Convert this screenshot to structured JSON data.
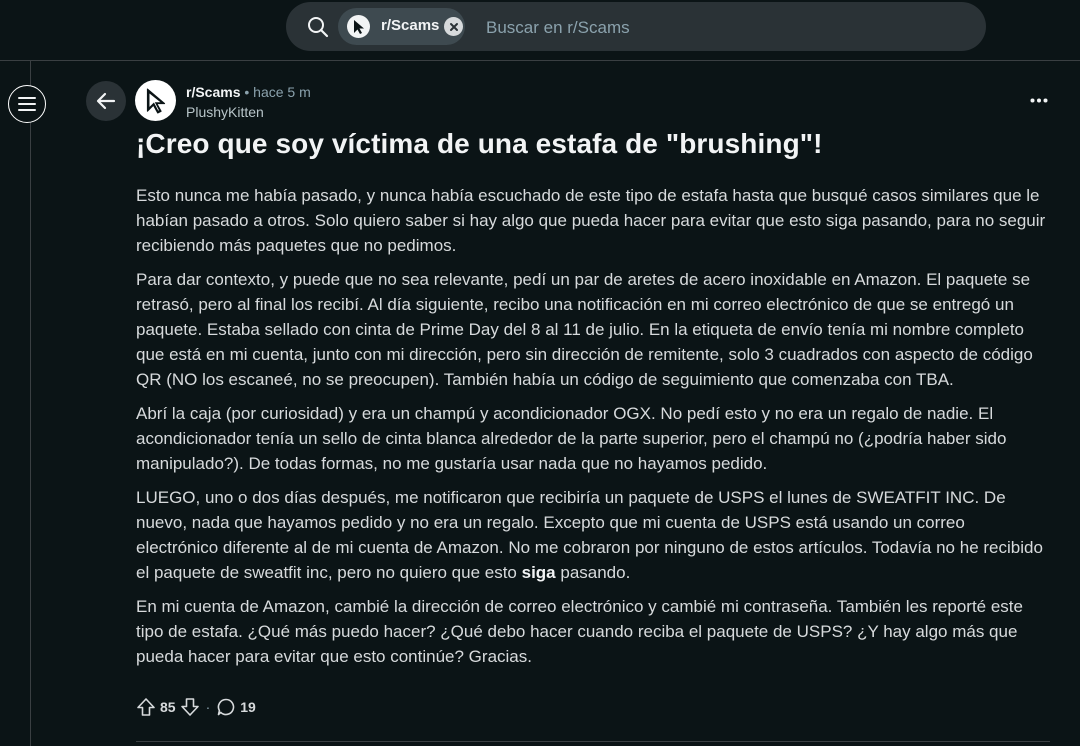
{
  "search": {
    "chip_label": "r/Scams",
    "placeholder": "Buscar en r/Scams"
  },
  "post": {
    "subreddit": "r/Scams",
    "separator": "•",
    "time": "hace 5 m",
    "author": "PlushyKitten",
    "title": "¡Creo que soy víctima de una estafa de \"brushing\"!",
    "paragraphs": [
      "Esto nunca me había pasado, y nunca había escuchado de este tipo de estafa hasta que busqué casos similares que le habían pasado a otros. Solo quiero saber si hay algo que pueda hacer para evitar que esto siga pasando, para no seguir recibiendo más paquetes que no pedimos.",
      "Para dar contexto, y puede que no sea relevante, pedí un par de aretes de acero inoxidable en Amazon. El paquete se retrasó, pero al final los recibí. Al día siguiente, recibo una notificación en mi correo electrónico de que se entregó un paquete. Estaba sellado con cinta de Prime Day del 8 al 11 de julio. En la etiqueta de envío tenía mi nombre completo que está en mi cuenta, junto con mi dirección, pero sin dirección de remitente, solo 3 cuadrados con aspecto de código QR (NO los escaneé, no se preocupen). También había un código de seguimiento que comenzaba con TBA.",
      "Abrí la caja (por curiosidad) y era un champú y acondicionador OGX. No pedí esto y no era un regalo de nadie. El acondicionador tenía un sello de cinta blanca alrededor de la parte superior, pero el champú no (¿podría haber sido manipulado?). De todas formas, no me gustaría usar nada que no hayamos pedido.",
      "En mi cuenta de Amazon, cambié la dirección de correo electrónico y cambié mi contraseña. También les reporté este tipo de estafa. ¿Qué más puedo hacer? ¿Qué debo hacer cuando reciba el paquete de USPS? ¿Y hay algo más que pueda hacer para evitar que esto continúe? Gracias."
    ],
    "p4_before": "LUEGO, uno o dos días después, me notificaron que recibiría un paquete de USPS el lunes de SWEATFIT INC. De nuevo, nada que hayamos pedido y no era un regalo. Excepto que mi cuenta de USPS está usando un correo electrónico diferente al de mi cuenta de Amazon. No me cobraron por ninguno de estos artículos. Todavía no he recibido el paquete de sweatfit inc, pero no quiero que esto ",
    "p4_bold": "siga",
    "p4_after": " pasando.",
    "score": "85",
    "action_sep": "·",
    "comments": "19"
  }
}
